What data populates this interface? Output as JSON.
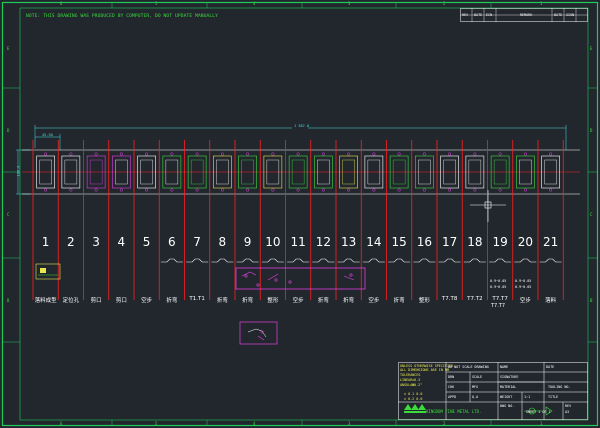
{
  "drawing": {
    "note": "NOTE: THIS DRAWING WAS PRODUCED BY COMPUTER, DO NOT UPDATE MANUALLY",
    "border_numbers_top": [
      "6",
      "5",
      "4",
      "3",
      "2",
      "1"
    ],
    "border_letters": [
      "E",
      "D",
      "C",
      "B"
    ],
    "overall_dimension": "1 587.0",
    "left_dimension": "45.50",
    "height_dimension": "100.0"
  },
  "stations": [
    {
      "number": "1",
      "label": "落料成型"
    },
    {
      "number": "2",
      "label": "定位孔"
    },
    {
      "number": "3",
      "label": "剪口"
    },
    {
      "number": "4",
      "label": "剪口"
    },
    {
      "number": "5",
      "label": "空步"
    },
    {
      "number": "6",
      "label": "折弯"
    },
    {
      "number": "7",
      "label": "T1.T1"
    },
    {
      "number": "8",
      "label": "折弯"
    },
    {
      "number": "9",
      "label": "折弯"
    },
    {
      "number": "10",
      "label": "整形"
    },
    {
      "number": "11",
      "label": "空步"
    },
    {
      "number": "12",
      "label": "折弯"
    },
    {
      "number": "13",
      "label": "折弯"
    },
    {
      "number": "14",
      "label": "空步"
    },
    {
      "number": "15",
      "label": "折弯"
    },
    {
      "number": "16",
      "label": "整形"
    },
    {
      "number": "17",
      "label": "T7.T8"
    },
    {
      "number": "18",
      "label": "T7.T2"
    },
    {
      "number": "19",
      "label": "T7.T7"
    },
    {
      "number": "20",
      "label": "空步"
    },
    {
      "number": "21",
      "label": "落料"
    }
  ],
  "station_notes": {
    "s19a": "0.9~0.05",
    "s19b": "0.9~0.05",
    "s20a": "0.9~0.05",
    "s20b": "0.9~0.05",
    "s19_label": "空步",
    "s19_sub": "T7.T7"
  },
  "title_block": {
    "unless_noted": "UNLESS OTHERWISE SPECIFIED",
    "dimensions": "ALL DIMENSIONS ARE IN MM",
    "tolerances": "TOLERANCES",
    "linear": "LINEAR",
    "angular": "ANGULAR",
    "tol_values": [
      "±0.3",
      "±0.2°",
      "± 0.1 0.0",
      "± 0.2 0.0"
    ],
    "no_scale": "DO NOT SCALE DRAWING",
    "scale_label": "SCALE",
    "scale_value": "1:1",
    "rev": "REV",
    "name_col": "NAME",
    "sign_col": "SIGNATURE",
    "date_col": "DATE",
    "drawn": "DRN",
    "chkd": "CHK",
    "appd": "APPD",
    "mfg": "MFG",
    "qa": "Q.A",
    "material": "MATERIAL",
    "weight": "WEIGHT",
    "title_label": "TITLE",
    "dwg_no": "DWG NO.",
    "sheet_label": "SHEET 1 OF 1",
    "size": "A3",
    "drawing_no": "TOOLING NO.",
    "company": "KINGDOM FINE METAL LTD."
  },
  "revision_block": {
    "headers": [
      "REV",
      "DATE",
      "ECN",
      "REMARK",
      "DATE",
      "SIGN"
    ]
  },
  "colors": {
    "background": "#22272e",
    "border": "#1fc95a",
    "red_lines": "#ff2020",
    "magenta": "#e040e0",
    "cyan": "#40e0e0",
    "yellow": "#e8e84a",
    "green": "#3cdc3c",
    "white": "#ffffff"
  }
}
